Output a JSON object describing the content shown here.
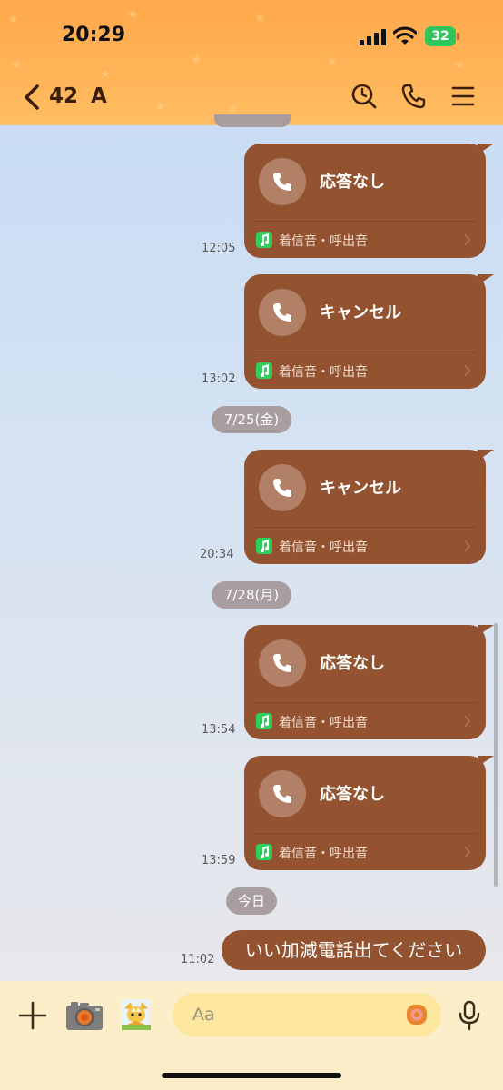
{
  "status_bar": {
    "time": "20:29",
    "battery": "32"
  },
  "header": {
    "unread_count": "42",
    "chat_name": "A"
  },
  "messages": [
    {
      "status": "応答なし",
      "ringtone": "着信音・呼出音",
      "time": "12:05"
    },
    {
      "status": "キャンセル",
      "ringtone": "着信音・呼出音",
      "time": "13:02"
    },
    {
      "status": "キャンセル",
      "ringtone": "着信音・呼出音",
      "time": "20:34"
    },
    {
      "status": "応答なし",
      "ringtone": "着信音・呼出音",
      "time": "13:54"
    },
    {
      "status": "応答なし",
      "ringtone": "着信音・呼出音",
      "time": "13:59"
    }
  ],
  "date_separators": [
    "7/25(金)",
    "7/28(月)",
    "今日"
  ],
  "text_message": {
    "text": "いい加減電話出てください",
    "time": "11:02"
  },
  "input": {
    "placeholder": "Aa"
  },
  "colors": {
    "bubble": "#935331",
    "header": "#ffb458",
    "input_bar": "#fbeec8"
  },
  "icons": [
    "back-chevron-icon",
    "search-clock-icon",
    "phone-icon",
    "menu-icon",
    "plus-icon",
    "camera-icon",
    "sticker-icon",
    "emoji-icon",
    "mic-icon",
    "music-note-icon"
  ]
}
